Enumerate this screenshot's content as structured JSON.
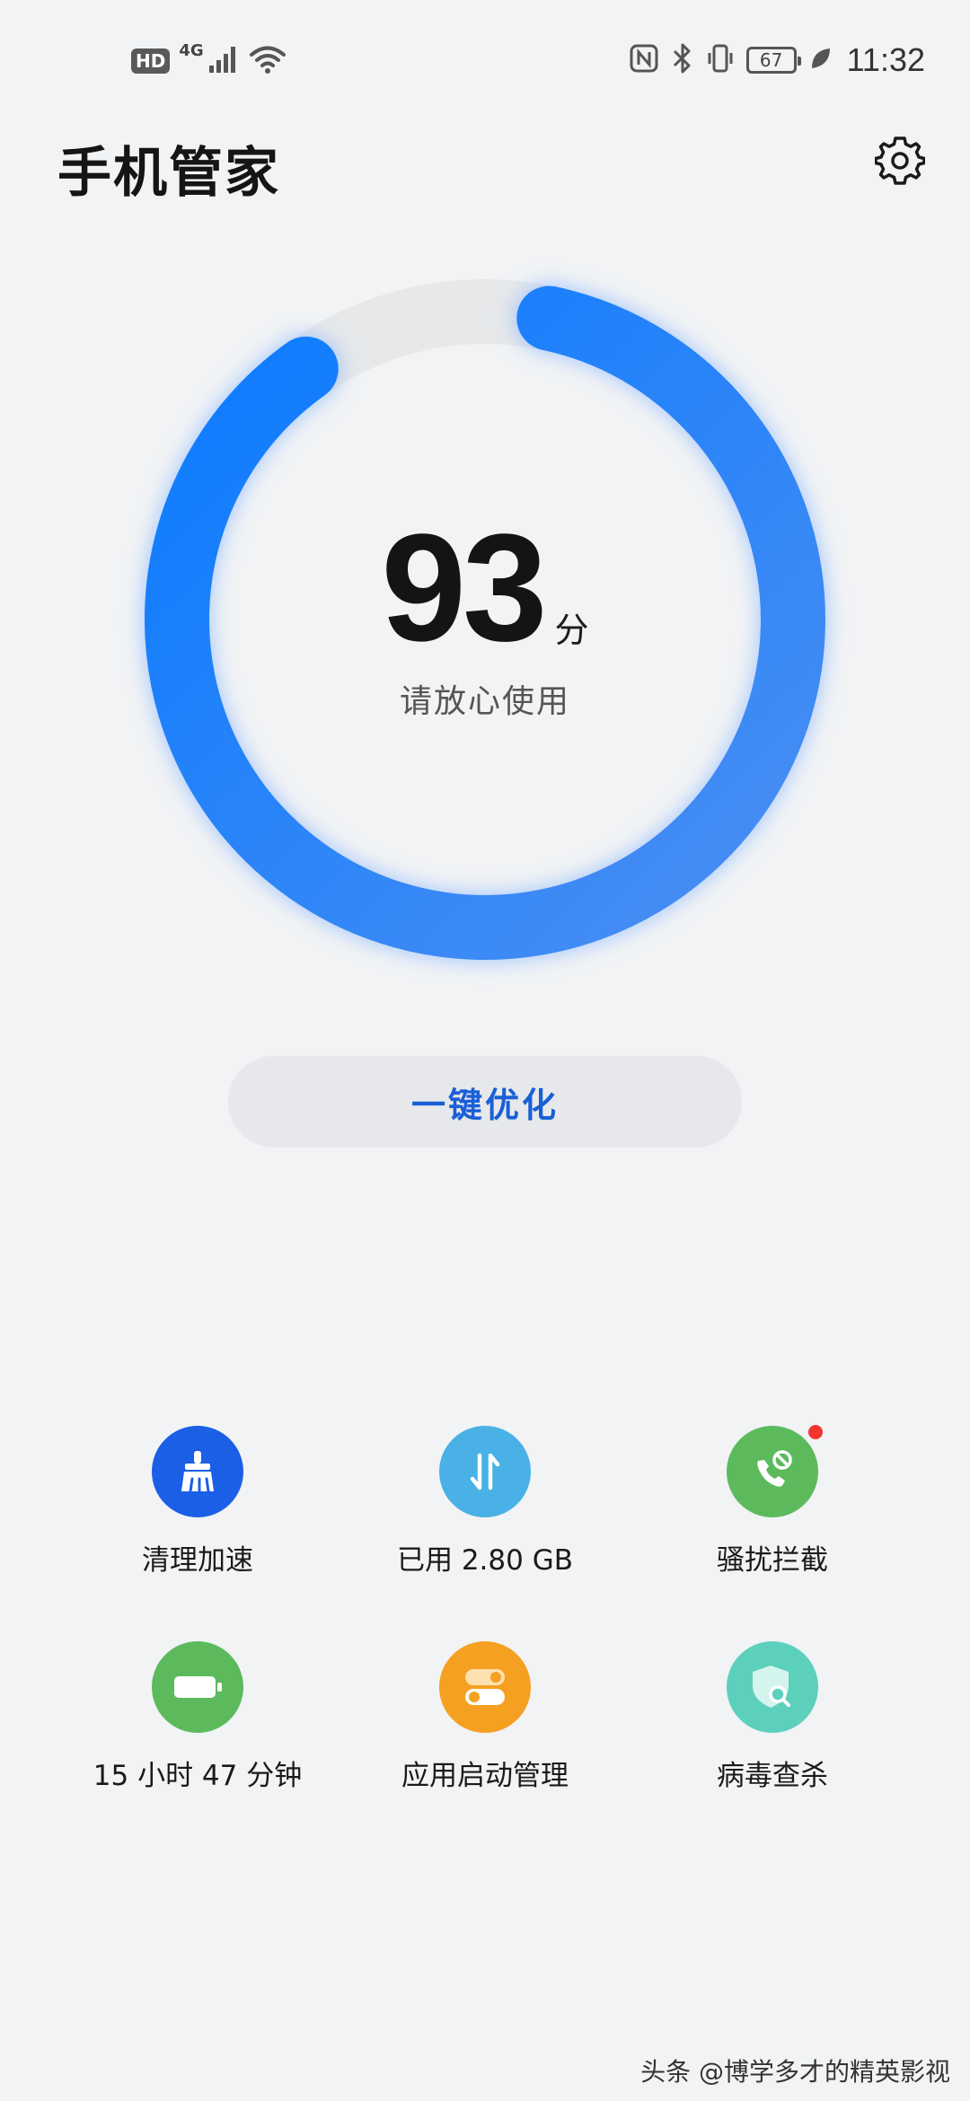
{
  "status_bar": {
    "hd": "HD",
    "network": "4G",
    "battery_level": "67",
    "time": "11:32"
  },
  "header": {
    "title": "手机管家"
  },
  "score": {
    "value": "93",
    "unit": "分",
    "status": "请放心使用",
    "level": 0.93
  },
  "optimize_button": {
    "label": "一键优化"
  },
  "tools": [
    {
      "label": "清理加速",
      "icon": "broom-icon",
      "color": "#1a5fe6"
    },
    {
      "label": "已用 2.80 GB",
      "icon": "data-transfer-icon",
      "color": "#49b1e6"
    },
    {
      "label": "骚扰拦截",
      "icon": "phone-block-icon",
      "color": "#5cba5c",
      "badge": true
    },
    {
      "label": "15 小时 47 分钟",
      "icon": "battery-icon",
      "color": "#5cba5c"
    },
    {
      "label": "应用启动管理",
      "icon": "toggle-switch-icon",
      "color": "#f5a021"
    },
    {
      "label": "病毒查杀",
      "icon": "shield-scan-icon",
      "color": "#5dd0bc"
    }
  ],
  "watermark": "头条 @博学多才的精英影视",
  "colors": {
    "background": "#f1f3f5",
    "ring_start": "#0a7bff",
    "ring_end": "#4b8ef2",
    "ring_track": "#e6e8ea",
    "accent": "#1a5fd6"
  }
}
